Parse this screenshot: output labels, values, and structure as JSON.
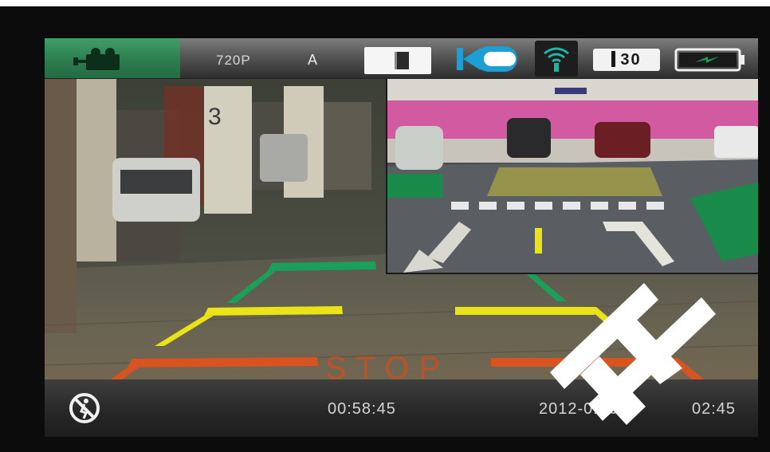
{
  "status_bar": {
    "mode_icon": "video-camera-icon",
    "resolution": "720P",
    "exposure": "A",
    "pip_toggle_icon": "pip-toggle-icon",
    "camera_icon": "rear-camera-icon",
    "wifi_icon": "wifi-icon",
    "timer": "30",
    "battery_icon": "battery-charging-icon"
  },
  "overlay": {
    "stop_text": "STOP"
  },
  "bottom_bar": {
    "motion_icon": "motion-detection-off-icon",
    "elapsed": "00:58:45",
    "date": "2012-01-01",
    "clock": "02:45"
  },
  "colors": {
    "mode_tab": "#2d7d50",
    "guide_green": "#1aa05a",
    "guide_yellow": "#e9e317",
    "guide_red": "#d8531f",
    "pip_wall_pink": "#d25aa0"
  }
}
